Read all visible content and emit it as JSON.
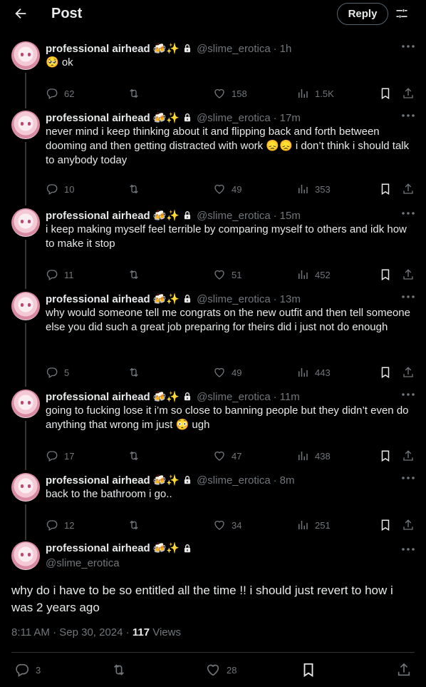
{
  "header": {
    "title": "Post",
    "reply_label": "Reply"
  },
  "user": {
    "display_name": "professional airhead",
    "emojis": "🍻✨",
    "handle": "@slime_erotica"
  },
  "tweets": [
    {
      "time": "1h",
      "text": "🥺 ok",
      "replies": "62",
      "likes": "158",
      "views": "1.5K"
    },
    {
      "time": "17m",
      "text": "never mind i keep thinking about it and flipping back and forth between dooming and then getting distracted with work 😞😞 i don’t think i should talk to anybody today",
      "replies": "10",
      "likes": "49",
      "views": "353"
    },
    {
      "time": "15m",
      "text": "i keep making myself feel terrible by comparing myself to others and idk how to make it stop",
      "replies": "11",
      "likes": "51",
      "views": "452"
    },
    {
      "time": "13m",
      "text": "why would someone tell me congrats on the new outfit and then tell someone else you did such a great job preparing for theirs did i just not do enough",
      "replies": "5",
      "likes": "49",
      "views": "443"
    },
    {
      "time": "11m",
      "text": "going to fucking lose it i’m so close to banning people but they didn’t even do anything that wrong im just 😳 ugh",
      "replies": "17",
      "likes": "47",
      "views": "438"
    },
    {
      "time": "8m",
      "text": "back to the bathroom i go..",
      "replies": "12",
      "likes": "34",
      "views": "251"
    }
  ],
  "main": {
    "text": "why do i have to be so entitled all the time !! i should just revert to how i was 2 years ago",
    "timestamp": "8:11 AM · Sep 30, 2024",
    "views_count": "117",
    "views_label": "Views",
    "replies": "3",
    "likes": "28"
  }
}
